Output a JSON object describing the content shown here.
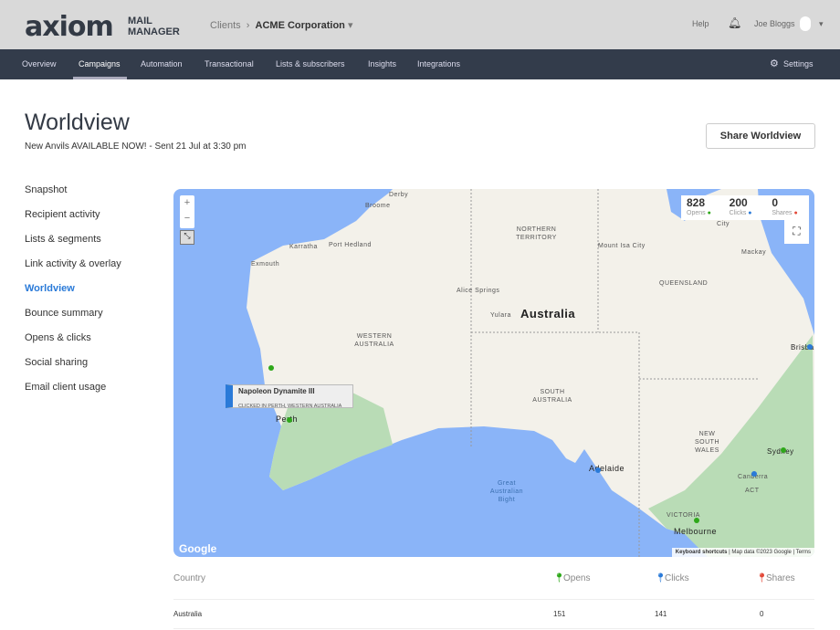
{
  "header": {
    "logo": "axiom",
    "logo_sub": "MAIL MANAGER",
    "breadcrumb_root": "Clients",
    "breadcrumb_current": "ACME Corporation",
    "help": "Help",
    "user": "Joe Bloggs"
  },
  "nav": {
    "items": [
      "Overview",
      "Campaigns",
      "Automation",
      "Transactional",
      "Lists & subscribers",
      "Insights",
      "Integrations"
    ],
    "active": "Campaigns",
    "settings": "Settings"
  },
  "page": {
    "title": "Worldview",
    "subtitle": "New Anvils AVAILABLE NOW!  - Sent 21 Jul at 3:30 pm",
    "share_button": "Share Worldview"
  },
  "sidebar": {
    "items": [
      "Snapshot",
      "Recipient activity",
      "Lists & segments",
      "Link activity & overlay",
      "Worldview",
      "Bounce summary",
      "Opens & clicks",
      "Social sharing",
      "Email client usage"
    ],
    "active": "Worldview"
  },
  "map": {
    "stats": {
      "opens": "828",
      "opens_label": "Opens",
      "clicks": "200",
      "clicks_label": "Clicks",
      "shares": "0",
      "shares_label": "Shares"
    },
    "labels": {
      "country": "Australia",
      "nt": "NORTHERN TERRITORY",
      "wa": "WESTERN AUSTRALIA",
      "sa": "SOUTH AUSTRALIA",
      "qld": "QUEENSLAND",
      "nsw": "NEW SOUTH WALES",
      "vic": "VICTORIA",
      "act": "ACT",
      "bight": "Great Australian Bight",
      "perth": "Perth",
      "adelaide": "Adelaide",
      "melbourne": "Melbourne",
      "sydney": "Sydney",
      "canberra": "Canberra",
      "brisbane": "Brisba",
      "alice": "Alice Springs",
      "yulara": "Yulara",
      "mountisa": "Mount Isa City",
      "derby": "Derby",
      "broome": "Broome",
      "karratha": "Karratha",
      "porthedland": "Port Hedland",
      "exmouth": "Exmouth",
      "mackay": "Mackay",
      "city": "City"
    },
    "tooltip": {
      "title": "Napoleon Dynamite III",
      "detail": "CLICKED IN PERTH, WESTERN AUSTRALIA"
    },
    "attribution": {
      "shortcuts": "Keyboard shortcuts",
      "data": "Map data ©2023 Google",
      "terms": "Terms"
    },
    "google": "Google",
    "colors": {
      "opens": "#2ea81a",
      "clicks": "#2a7ad8",
      "shares": "#e34a3a"
    }
  },
  "table": {
    "headers": [
      "Country",
      "Opens",
      "Clicks",
      "Shares"
    ],
    "rows": [
      {
        "country": "Australia",
        "opens": "151",
        "clicks": "141",
        "shares": "0"
      }
    ]
  }
}
